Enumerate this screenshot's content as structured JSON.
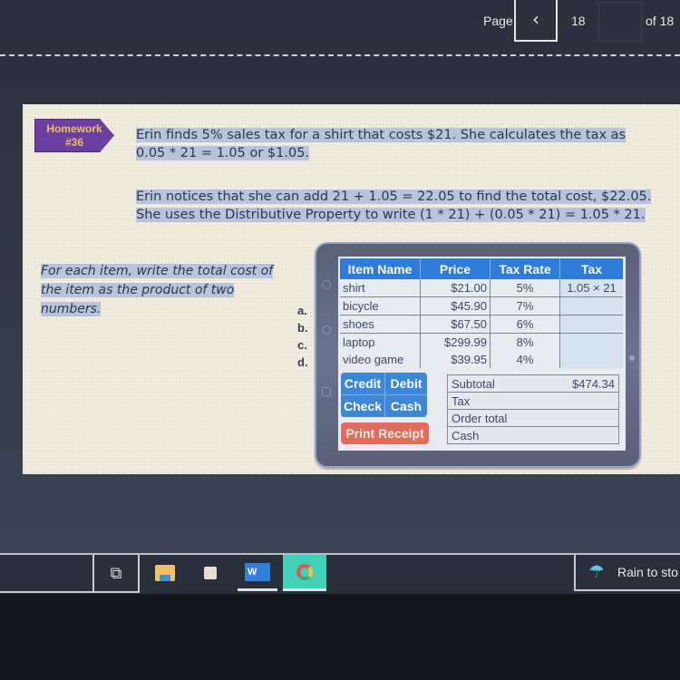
{
  "pagination": {
    "label": "Page",
    "prev_icon": "‹",
    "current": "18",
    "of_label": "of 18"
  },
  "slide": {
    "badge": {
      "line1": "Homework",
      "line2": "#36"
    },
    "paragraph1": {
      "line1": "Erin finds 5% sales tax for a shirt that costs $21. She calculates the tax as",
      "line2": "0.05 * 21 = 1.05 or $1.05."
    },
    "paragraph2": {
      "line1": "Erin notices that she can add 21 + 1.05 = 22.05 to find the total cost, $22.05.",
      "line2": "She uses the Distributive Property to write (1 * 21) + (0.05 * 21) = 1.05 * 21."
    },
    "instruction": "For each item, write the total cost of the item as the product of two numbers.",
    "item_letters": [
      "a.",
      "b.",
      "c.",
      "d."
    ]
  },
  "register": {
    "headers": [
      "Item Name",
      "Price",
      "Tax Rate",
      "Tax"
    ],
    "rows": [
      {
        "name": "shirt",
        "price": "$21.00",
        "rate": "5%",
        "tax": "1.05 × 21"
      },
      {
        "name": "bicycle",
        "price": "$45.90",
        "rate": "7%",
        "tax": ""
      },
      {
        "name": "shoes",
        "price": "$67.50",
        "rate": "6%",
        "tax": ""
      },
      {
        "name": "laptop",
        "price": "$299.99",
        "rate": "8%",
        "tax": ""
      },
      {
        "name": "video game",
        "price": "$39.95",
        "rate": "4%",
        "tax": ""
      }
    ],
    "payment_buttons": [
      "Credit",
      "Debit",
      "Check",
      "Cash"
    ],
    "print_button": "Print Receipt",
    "summary": [
      {
        "label": "Subtotal",
        "value": "$474.34"
      },
      {
        "label": "Tax",
        "value": ""
      },
      {
        "label": "Order total",
        "value": ""
      },
      {
        "label": "Cash",
        "value": ""
      }
    ],
    "colors": {
      "header_blue": "#2f7bd8",
      "print_red": "#e46a5c"
    }
  },
  "taskbar": {
    "apps": [
      "task-view",
      "file-explorer",
      "microsoft-store",
      "word",
      "chrome"
    ],
    "word_label": "W",
    "weather_text": "Rain to sto",
    "weather_icon": "☂"
  }
}
